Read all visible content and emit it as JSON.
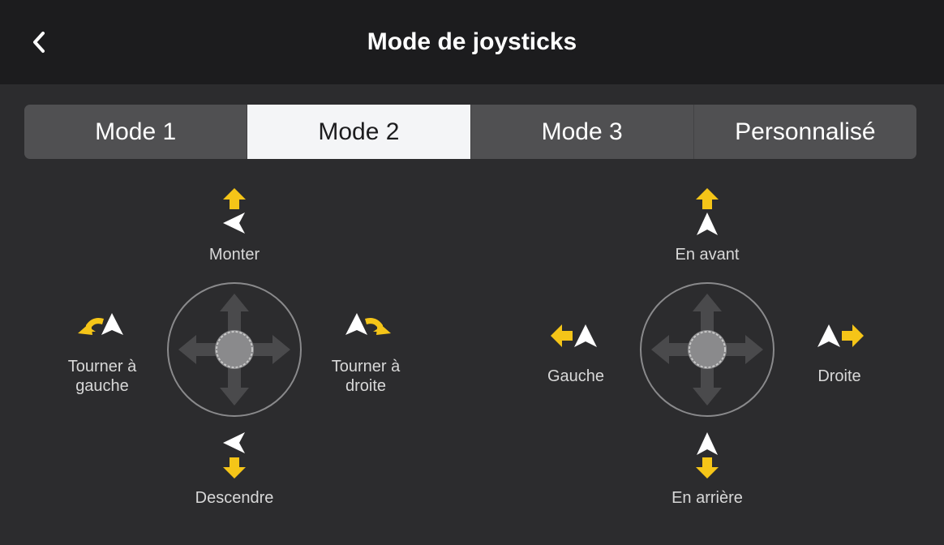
{
  "header": {
    "title": "Mode de joysticks",
    "back_icon": "chevron-left-icon"
  },
  "tabs": [
    {
      "label": "Mode 1",
      "active": false
    },
    {
      "label": "Mode 2",
      "active": true
    },
    {
      "label": "Mode 3",
      "active": false
    },
    {
      "label": "Personnalisé",
      "active": false
    }
  ],
  "left_stick": {
    "up_label": "Monter",
    "down_label": "Descendre",
    "left_label": "Tourner à\ngauche",
    "right_label": "Tourner à\ndroite"
  },
  "right_stick": {
    "up_label": "En avant",
    "down_label": "En arrière",
    "left_label": "Gauche",
    "right_label": "Droite"
  },
  "colors": {
    "accent_yellow": "#f5c518",
    "header_bg": "#1c1c1e",
    "body_bg": "#2c2c2e"
  }
}
